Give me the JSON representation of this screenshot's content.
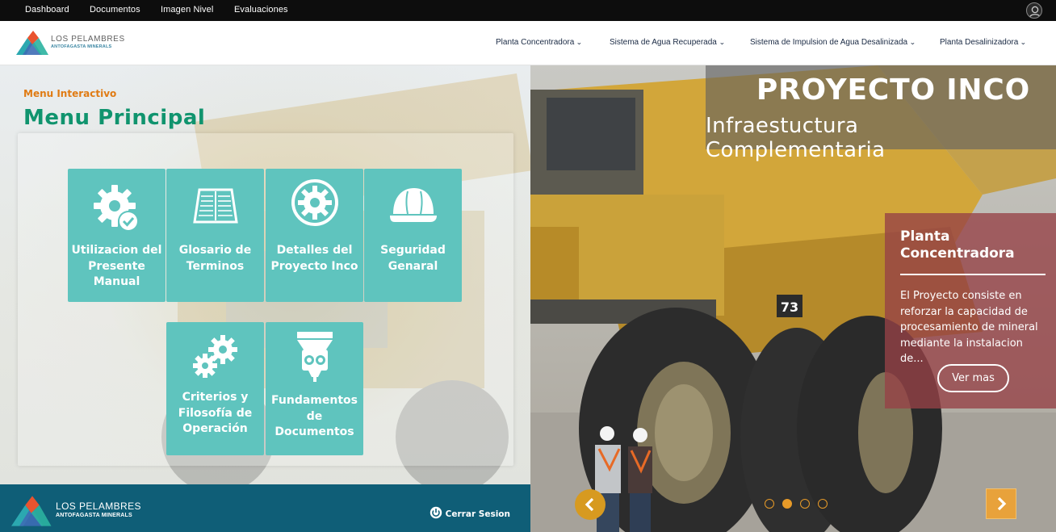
{
  "topbar": {
    "links": [
      "Dashboard",
      "Documentos",
      "Imagen Nivel",
      "Evaluaciones"
    ]
  },
  "header": {
    "logo": {
      "line1": "LOS PELAMBRES",
      "line2": "ANTOFAGASTA MINERALS"
    },
    "nav": [
      "Planta Concentradora",
      "Sistema de Agua Recuperada",
      "Sistema de Impulsion de Agua Desalinizada",
      "Planta Desalinizadora"
    ]
  },
  "menu": {
    "subtitle": "Menu Interactivo",
    "title": "Menu Principal",
    "tiles": [
      {
        "label": "Utilizacion del Presente Manual",
        "icon": "gear-check-icon"
      },
      {
        "label": "Glosario de Terminos",
        "icon": "open-book-icon"
      },
      {
        "label": "Detalles del Proyecto Inco",
        "icon": "gear-circle-icon"
      },
      {
        "label": "Seguridad Genaral",
        "icon": "hard-hat-icon"
      },
      {
        "label": "Criterios y Filosofía de Operación",
        "icon": "gears-icon"
      },
      {
        "label": "Fundamentos de Documentos",
        "icon": "funnel-gears-icon"
      }
    ]
  },
  "footer": {
    "logo": {
      "line1": "LOS PELAMBRES",
      "line2": "ANTOFAGASTA MINERALS"
    },
    "logout": "Cerrar Sesion"
  },
  "hero": {
    "title": "PROYECTO INCO",
    "subtitle": "Infraestuctura Complementaria",
    "info_title": "Planta Concentradora",
    "info_text": "El Proyecto consiste en reforzar la capacidad de procesamiento de mineral mediante la instalacion de...",
    "button": "Ver mas",
    "truck_number": "73",
    "slides": 4,
    "active_slide": 2
  },
  "colors": {
    "accent_teal": "#5fc4be",
    "title_green": "#10946e",
    "subtitle_orange": "#e07b13",
    "footer_blue": "#0f5e77",
    "info_red": "#964146",
    "arrow_orange": "#d79a20"
  }
}
